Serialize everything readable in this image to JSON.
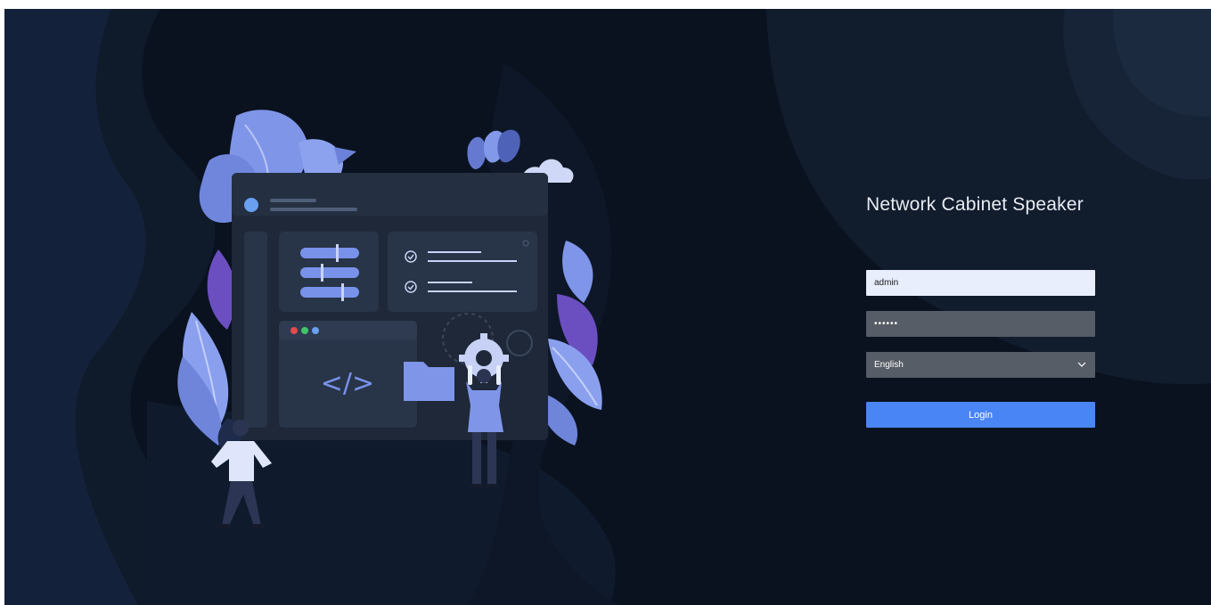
{
  "app": {
    "title": "Network Cabinet Speaker"
  },
  "login": {
    "username_value": "admin",
    "password_mask": "••••••",
    "language_selected": "English",
    "login_label": "Login"
  },
  "illustration": {
    "code_glyph": "</>"
  },
  "colors": {
    "background": "#0a1220",
    "accent": "#4a85f6",
    "input_light": "#e8eefc",
    "input_dark": "#575d66"
  },
  "icons": [
    "chevron-down-icon",
    "check-circle-icon",
    "gear-icon",
    "folder-icon",
    "cloud-icon",
    "window-dots-icon",
    "code-icon"
  ]
}
